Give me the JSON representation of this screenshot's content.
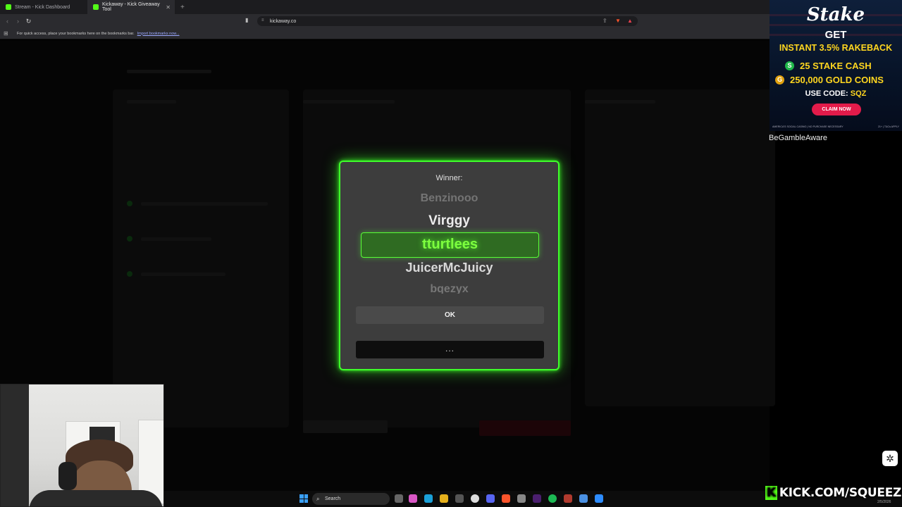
{
  "browser": {
    "tabs": [
      {
        "label": "Stream - Kick Dashboard",
        "active": false
      },
      {
        "label": "Kickaway - Kick Giveaway Tool",
        "active": true
      }
    ],
    "new_tab": "+",
    "url": "kickaway.co",
    "bookmarks_hint": "For quick access, place your bookmarks here on the bookmarks bar.",
    "import_link": "Import bookmarks now..."
  },
  "modal": {
    "winner_label": "Winner:",
    "names": [
      "Benzinooo",
      "Virggy",
      "tturtlees",
      "JuicerMcJuicy",
      "bqezyx"
    ],
    "selected": "tturtlees",
    "ok_label": "OK",
    "more_label": "...",
    "accent": "#3eff2a"
  },
  "ad": {
    "logo": "Stake",
    "headline": "GET",
    "line1": "INSTANT 3.5% RAKEBACK",
    "line2": "25 STAKE CASH",
    "line3": "250,000 GOLD COINS",
    "code_label": "USE CODE:",
    "code": "SQZ",
    "claim": "CLAIM NOW",
    "fine_left": "AMERICA'S SOCIAL CASINO | NO PURCHASE NECESSARY",
    "fine_right": "21+ | T&Cs APPLY",
    "coin_s": "S",
    "coin_g": "G"
  },
  "gamble_aware": "BeGambleAware",
  "taskbar": {
    "search": "Search"
  },
  "overlay": {
    "kick_k": "K",
    "kick_url": "KICK.COM/SQUEEZE",
    "date": "2/5/2026"
  }
}
